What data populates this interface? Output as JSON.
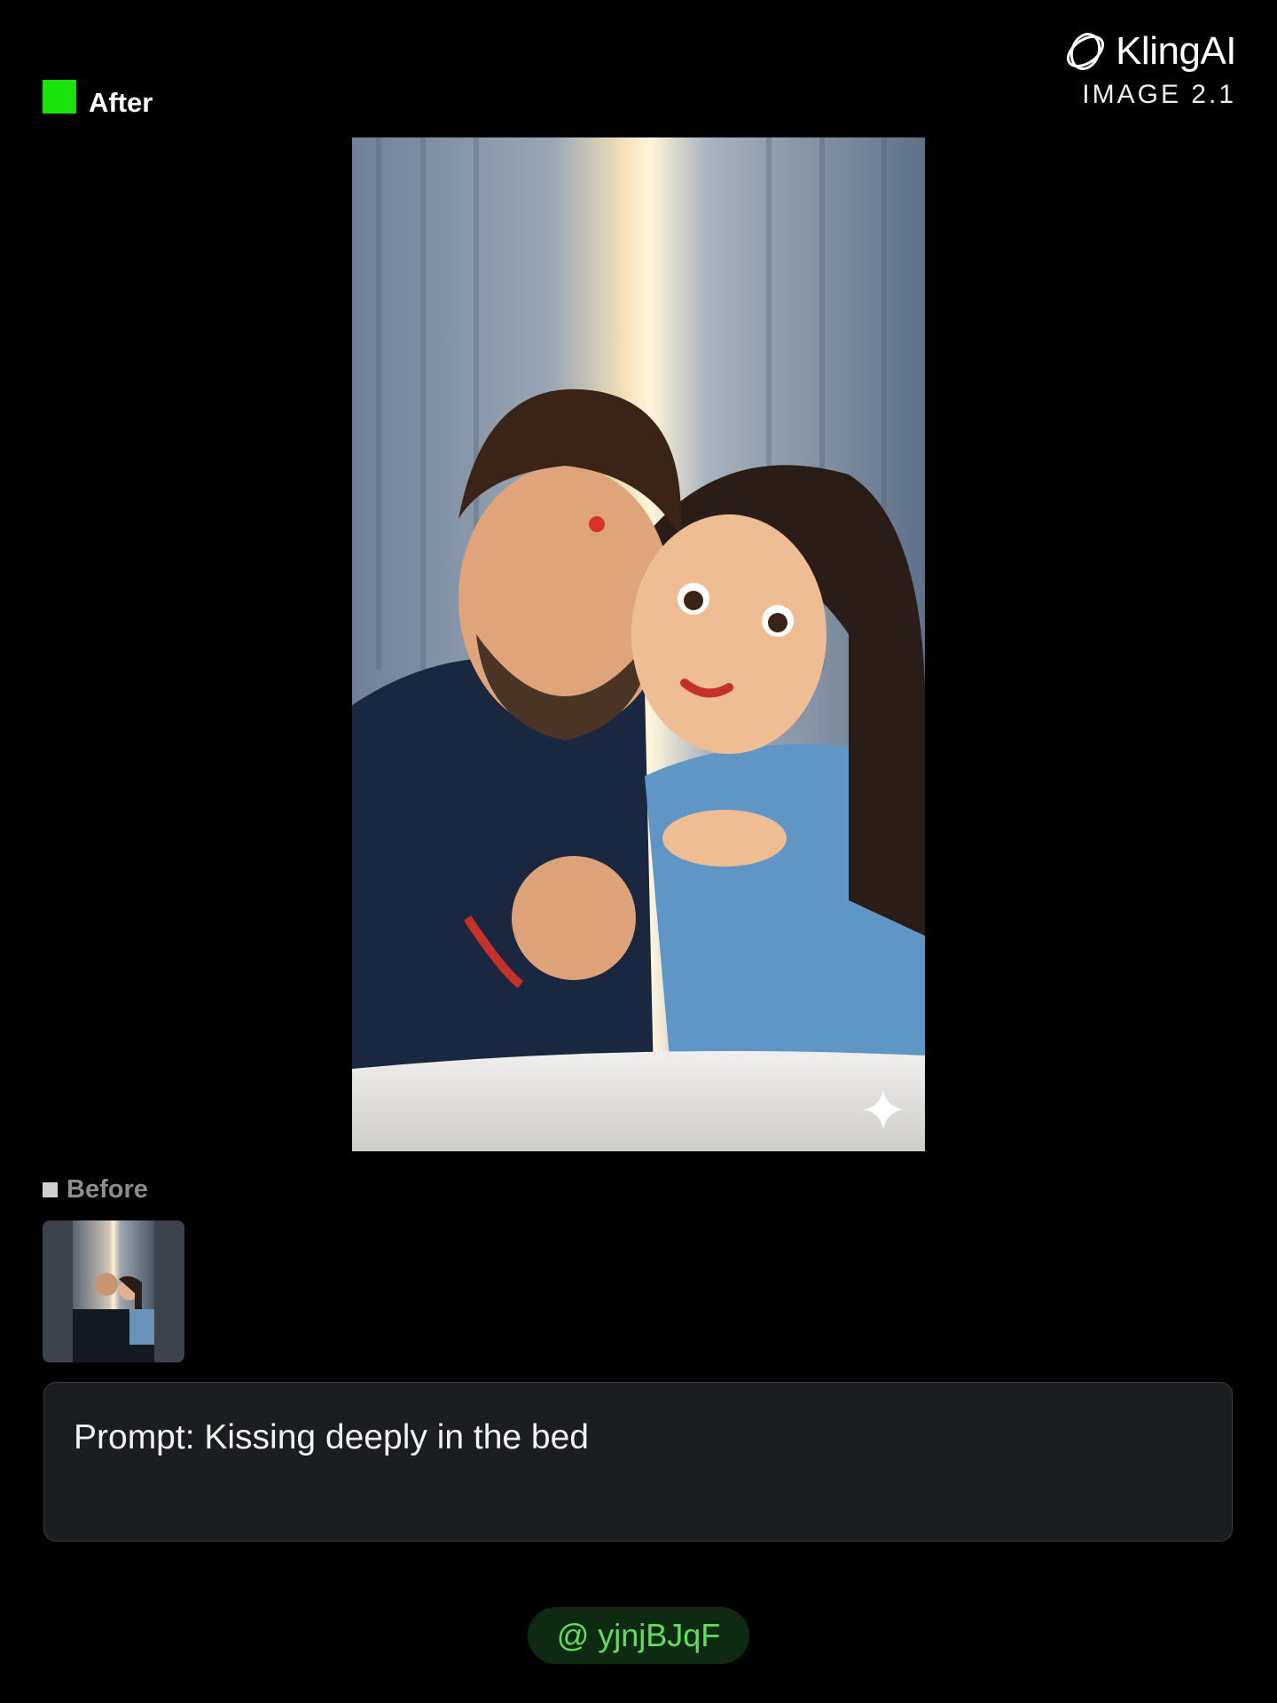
{
  "header": {
    "after_label": "After",
    "after_swatch_color": "#19e30b",
    "brand_logo_icon": "kling-orbit-icon",
    "brand_name": "KlingAI",
    "brand_product": "IMAGE 2.1"
  },
  "result_image": {
    "sparkle_icon": "four-point-star-icon"
  },
  "before": {
    "label": "Before"
  },
  "prompt": {
    "text": "Prompt: Kissing deeply in the bed"
  },
  "user": {
    "handle": "@ yjnjBJqF",
    "accent_color": "#5fe05a"
  }
}
